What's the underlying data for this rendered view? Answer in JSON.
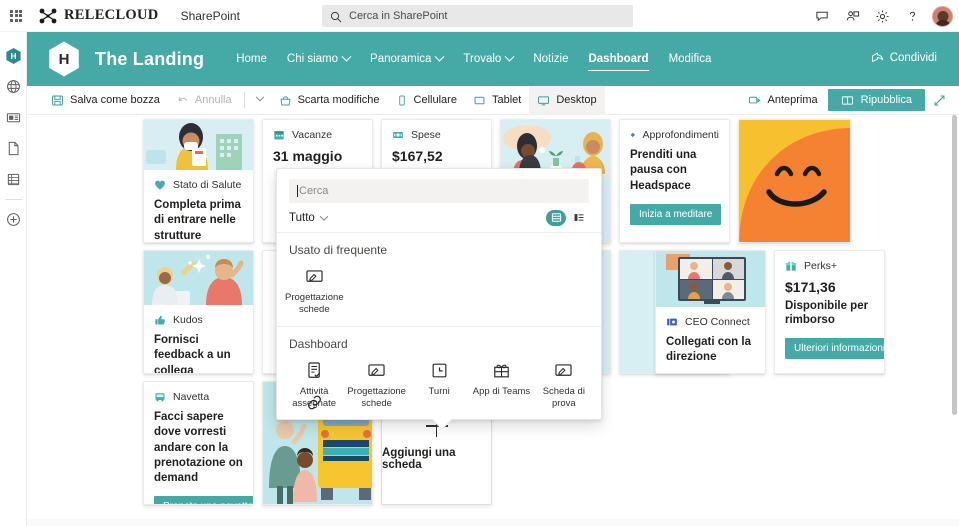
{
  "suite": {
    "waffle_label": "app-launcher",
    "brand": "RELECLOUD",
    "app": "SharePoint",
    "search_placeholder": "Cerca in SharePoint",
    "icons": [
      "chat-icon",
      "meet-icon",
      "gear-icon",
      "help-icon"
    ],
    "avatar_label": "user-avatar"
  },
  "rail": {
    "items": [
      {
        "name": "site-home-icon",
        "label": "H"
      },
      {
        "name": "globe-icon",
        "label": ""
      },
      {
        "name": "news-icon",
        "label": ""
      },
      {
        "name": "page-icon",
        "label": ""
      },
      {
        "name": "list-icon",
        "label": ""
      },
      {
        "name": "create-icon",
        "label": ""
      }
    ]
  },
  "site": {
    "title": "The Landing",
    "logo_letter": "H",
    "nav": [
      {
        "label": "Home",
        "has_chevron": false,
        "active": false
      },
      {
        "label": "Chi siamo",
        "has_chevron": true,
        "active": false
      },
      {
        "label": "Panoramica",
        "has_chevron": true,
        "active": false
      },
      {
        "label": "Trovalo",
        "has_chevron": true,
        "active": false
      },
      {
        "label": "Notizie",
        "has_chevron": false,
        "active": false
      },
      {
        "label": "Dashboard",
        "has_chevron": false,
        "active": true
      },
      {
        "label": "Modifica",
        "has_chevron": false,
        "active": false
      }
    ],
    "share_label": "Condividi"
  },
  "commandbar": {
    "save_draft": "Salva come bozza",
    "undo": "Annulla",
    "discard": "Scarta modifiche",
    "mobile": "Cellulare",
    "tablet": "Tablet",
    "desktop": "Desktop",
    "preview": "Anteprima",
    "republish": "Ripubblica",
    "expand_label": "expand-icon"
  },
  "cards": [
    {
      "id": "health",
      "badge": "Stato di Salute",
      "badge_icon": "heart-icon",
      "desc": "Completa prima di entrare nelle strutture",
      "image": "illustration-masked-person"
    },
    {
      "id": "vacanze",
      "badge": "Vacanze",
      "badge_icon": "calendar-icon",
      "big": "31 maggio",
      "desc": ""
    },
    {
      "id": "spese",
      "badge": "Spese",
      "badge_icon": "money-icon",
      "big": "$167,52",
      "desc": ""
    },
    {
      "id": "coffee",
      "badge": "",
      "image": "illustration-two-people-coffee"
    },
    {
      "id": "headspace",
      "badge": "Approfondimenti",
      "badge_icon": "diamond-icon",
      "desc": "Prenditi una pausa con Headspace",
      "button": "Inizia a meditare"
    },
    {
      "id": "smiley",
      "image": "illustration-orange-smiley"
    },
    {
      "id": "kudos",
      "badge": "Kudos",
      "badge_icon": "thumbsup-icon",
      "desc": "Fornisci feedback a un collega",
      "image": "illustration-high-five"
    },
    {
      "id": "ceoconnect",
      "badge": "CEO Connect",
      "badge_icon": "video-icon",
      "desc": "Collegati con la direzione",
      "image": "illustration-video-call"
    },
    {
      "id": "perks",
      "badge": "Perks+",
      "badge_icon": "gift-icon",
      "big": "$171,36",
      "sub": "Disponibile per rimborso",
      "button": "Ulteriori informazioni"
    },
    {
      "id": "navetta",
      "badge": "Navetta",
      "badge_icon": "bus-icon",
      "desc": "Facci sapere dove vorresti andare con la prenotazione on demand",
      "button": "Prenota una navetta"
    },
    {
      "id": "bus",
      "image": "illustration-bus-couple"
    }
  ],
  "addcard": {
    "label": "Aggiungi una scheda",
    "icon": "plus-icon"
  },
  "flyout": {
    "search_placeholder": "Cerca",
    "filter_label": "Tutto",
    "view_grid_icon": "grid-view-icon",
    "view_list_icon": "list-view-icon",
    "sections": [
      {
        "title": "Usato di frequente",
        "items": [
          {
            "label": "Progettazione schede",
            "icon": "card-designer-icon"
          }
        ]
      },
      {
        "title": "Dashboard",
        "items": [
          {
            "label": "Attività assegnate",
            "icon": "assigned-tasks-icon"
          },
          {
            "label": "Progettazione schede",
            "icon": "card-designer-icon"
          },
          {
            "label": "Turni",
            "icon": "clock-icon"
          },
          {
            "label": "App di Teams",
            "icon": "teams-apps-icon"
          },
          {
            "label": "Scheda di prova",
            "icon": "card-designer-icon"
          }
        ]
      },
      {
        "title": "",
        "items": [
          {
            "label": "",
            "icon": "link-icon"
          }
        ]
      }
    ]
  },
  "colors": {
    "teal": "#45aaa6",
    "teal_dark": "#3f9e9b",
    "canvas": "#ffffff",
    "card_border": "#edebe9",
    "text": "#201f1e",
    "muted": "#605e5c"
  }
}
